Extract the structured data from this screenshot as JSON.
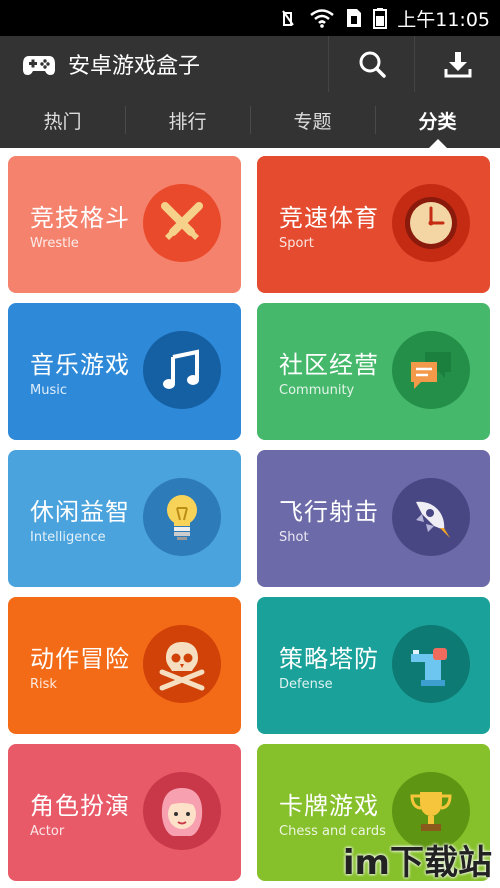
{
  "status": {
    "time": "上午11:05"
  },
  "app": {
    "title": "安卓游戏盒子",
    "logo_icon": "gamepad-icon",
    "search_icon": "search-icon",
    "download_icon": "download-icon"
  },
  "tabs": [
    {
      "label": "热门",
      "active": false
    },
    {
      "label": "排行",
      "active": false
    },
    {
      "label": "专题",
      "active": false
    },
    {
      "label": "分类",
      "active": true
    }
  ],
  "categories": [
    {
      "name": "竞技格斗",
      "en": "Wrestle",
      "color": "#f5826d",
      "badge": "#ea4a2c",
      "icon": "crossed-swords-icon"
    },
    {
      "name": "竞速体育",
      "en": "Sport",
      "color": "#e54c2f",
      "badge": "#c52a13",
      "icon": "clock-icon"
    },
    {
      "name": "音乐游戏",
      "en": "Music",
      "color": "#2e8ad9",
      "badge": "#155fa3",
      "icon": "music-note-icon"
    },
    {
      "name": "社区经营",
      "en": "Community",
      "color": "#46b86c",
      "badge": "#238f48",
      "icon": "chat-bubbles-icon"
    },
    {
      "name": "休闲益智",
      "en": "Intelligence",
      "color": "#4aa3dd",
      "badge": "#2d7bb9",
      "icon": "lightbulb-icon"
    },
    {
      "name": "飞行射击",
      "en": "Shot",
      "color": "#6c6aa8",
      "badge": "#484683",
      "icon": "rocket-icon"
    },
    {
      "name": "动作冒险",
      "en": "Risk",
      "color": "#f46b17",
      "badge": "#d04208",
      "icon": "skull-crossbones-icon"
    },
    {
      "name": "策略塔防",
      "en": "Defense",
      "color": "#1aa29a",
      "badge": "#0d7a74",
      "icon": "tower-defense-icon"
    },
    {
      "name": "角色扮演",
      "en": "Actor",
      "color": "#e95a68",
      "badge": "#c83848",
      "icon": "girl-face-icon"
    },
    {
      "name": "卡牌游戏",
      "en": "Chess and cards",
      "color": "#86c02b",
      "badge": "#5e9512",
      "icon": "trophy-icon"
    }
  ],
  "watermark": "im下载站"
}
